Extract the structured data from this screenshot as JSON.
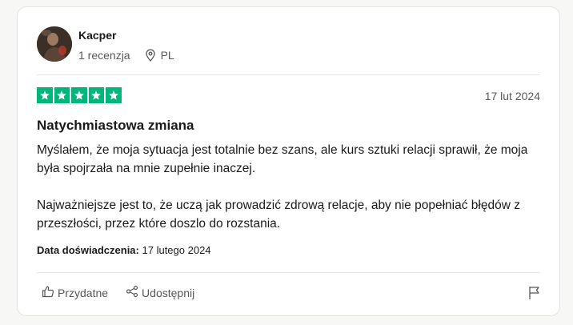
{
  "reviewer": {
    "name": "Kacper",
    "reviews_count": "1 recenzja",
    "country": "PL"
  },
  "review": {
    "rating": 5,
    "date": "17 lut 2024",
    "title": "Natychmiastowa zmiana",
    "paragraphs": [
      "Myślałem, że moja sytuacja jest totalnie bez szans, ale kurs sztuki relacji sprawił, że moja była spojrzała na mnie zupełnie inaczej.",
      "Najważniejsze jest to, że uczą jak prowadzić zdrową relacje, aby nie popełniać błędów z przeszłości, przez które doszlo do rozstania."
    ],
    "experience_label": "Data doświadczenia:",
    "experience_date": "17 lutego 2024"
  },
  "actions": {
    "useful_label": "Przydatne",
    "share_label": "Udostępnij"
  },
  "colors": {
    "star_green": "#00b67a",
    "muted_text": "#575757"
  },
  "icons": [
    "location-pin-icon",
    "star-icon",
    "thumbs-up-icon",
    "share-icon",
    "flag-icon"
  ]
}
